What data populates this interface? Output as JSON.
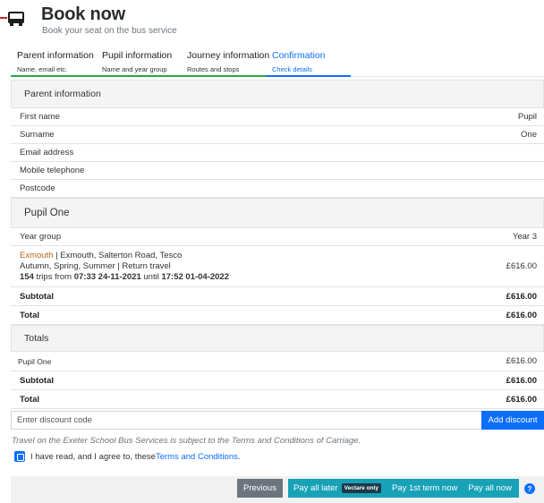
{
  "header": {
    "title": "Book now",
    "subtitle": "Book your seat on the bus service"
  },
  "steps": [
    {
      "title": "Parent information",
      "sub": "Name, email etc."
    },
    {
      "title": "Pupil information",
      "sub": "Name and year group"
    },
    {
      "title": "Journey information",
      "sub": "Routes and stops"
    },
    {
      "title": "Confirmation",
      "sub": "Check details"
    }
  ],
  "parent": {
    "heading": "Parent information",
    "rows": [
      {
        "label": "First name",
        "value": "Pupil"
      },
      {
        "label": "Surname",
        "value": "One"
      },
      {
        "label": "Email address",
        "value": ""
      },
      {
        "label": "Mobile telephone",
        "value": ""
      },
      {
        "label": "Postcode",
        "value": ""
      }
    ]
  },
  "pupil": {
    "heading": "Pupil One",
    "year_label": "Year group",
    "year_value": "Year 3",
    "journey": {
      "destination": "Exmouth",
      "route": " | Exmouth, Salterton Road, Tesco",
      "terms": "Autumn, Spring, Summer | Return travel",
      "trips": "154",
      "trips_from": " trips from ",
      "start": "07:33 24-11-2021",
      "until": " until ",
      "end": "17:52 01-04-2022",
      "price": "£616.00"
    },
    "subtotal_label": "Subtotal",
    "subtotal_value": "£616.00",
    "total_label": "Total",
    "total_value": "£616.00"
  },
  "totals": {
    "heading": "Totals",
    "pupil_label": "Pupil One",
    "pupil_value": "£616.00",
    "subtotal_label": "Subtotal",
    "subtotal_value": "£616.00",
    "total_label": "Total",
    "total_value": "£616.00"
  },
  "discount": {
    "placeholder": "Enter discount code",
    "button": "Add discount"
  },
  "terms_note": "Travel on the Exeter School Bus Services is subject to the Terms and Conditions of Carriage.",
  "agree": {
    "text": "I have read, and I agree to, these ",
    "link": "Terms and Conditions",
    "end": "."
  },
  "actions": {
    "previous": "Previous",
    "pay_later": "Pay all later",
    "pay_later_badge": "Vectare only",
    "pay_first_term": "Pay 1st term now",
    "pay_all_now": "Pay all now",
    "help": "?"
  },
  "colors": {
    "primary": "#0d6efd",
    "success": "#28a745",
    "info": "#17a2b8",
    "secondary": "#6c757d"
  },
  "icons": {
    "logo": "bus-icon",
    "help": "question-circle-icon"
  }
}
